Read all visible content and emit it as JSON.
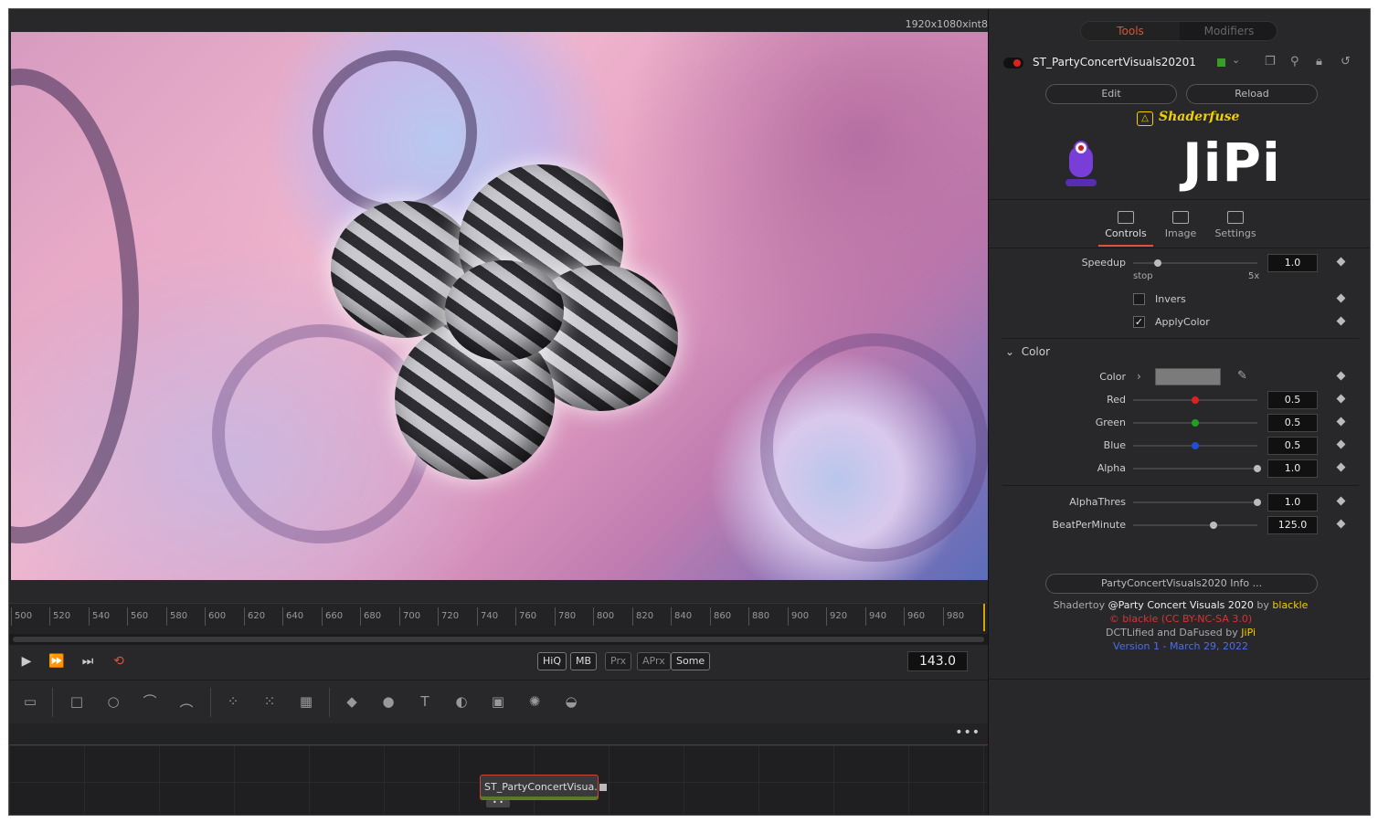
{
  "viewer": {
    "resolution": "1920x1080xint8"
  },
  "timeline": {
    "ticks": [
      "500",
      "520",
      "540",
      "560",
      "580",
      "600",
      "620",
      "640",
      "660",
      "680",
      "700",
      "720",
      "740",
      "760",
      "780",
      "800",
      "820",
      "840",
      "860",
      "880",
      "900",
      "920",
      "940",
      "960",
      "980"
    ],
    "current_time": "143.0"
  },
  "quality": {
    "hiq": "HiQ",
    "mb": "MB",
    "prx": "Prx",
    "aprx": "APrx",
    "some": "Some"
  },
  "node": {
    "label": "ST_PartyConcertVisua..."
  },
  "inspector": {
    "tabs": {
      "tools": "Tools",
      "modifiers": "Modifiers"
    },
    "tool_name": "ST_PartyConcertVisuals20201",
    "edit": "Edit",
    "reload": "Reload",
    "brand": "Shaderfuse",
    "logo": "JiPi",
    "subtabs": {
      "controls": "Controls",
      "image": "Image",
      "settings": "Settings"
    },
    "speedup": {
      "label": "Speedup",
      "value": "1.0",
      "min": "stop",
      "max": "5x",
      "level": 0.2
    },
    "invers": {
      "label": "Invers",
      "checked": ""
    },
    "applycolor": {
      "label": "ApplyColor",
      "checked": "✓"
    },
    "color_section": "Color",
    "color": {
      "label": "Color",
      "swatch": "#7b7b7b"
    },
    "red": {
      "label": "Red",
      "value": "0.5",
      "level": 0.5,
      "dot": "#e02020"
    },
    "green": {
      "label": "Green",
      "value": "0.5",
      "level": 0.5,
      "dot": "#20a020"
    },
    "blue": {
      "label": "Blue",
      "value": "0.5",
      "level": 0.5,
      "dot": "#2050d0"
    },
    "alpha": {
      "label": "Alpha",
      "value": "1.0",
      "level": 1.0
    },
    "alphathres": {
      "label": "AlphaThres",
      "value": "1.0",
      "level": 1.0
    },
    "bpm": {
      "label": "BeatPerMinute",
      "value": "125.0",
      "level": 0.65
    },
    "info_button": "PartyConcertVisuals2020 Info ...",
    "credits": {
      "l1a": "Shadertoy ",
      "l1b": "@Party Concert Visuals 2020",
      "l1c": " by ",
      "l1d": "blackle",
      "l2": "© blackle (CC BY-NC-SA 3.0)",
      "l3a": "DCTLified and DaFused by ",
      "l3b": "JiPi",
      "l4": "Version 1 - March 29, 2022"
    }
  },
  "colors": {
    "accent": "#e0503a",
    "yellow": "#f0d000",
    "red": "#e03030",
    "blue": "#4a6cf0"
  }
}
